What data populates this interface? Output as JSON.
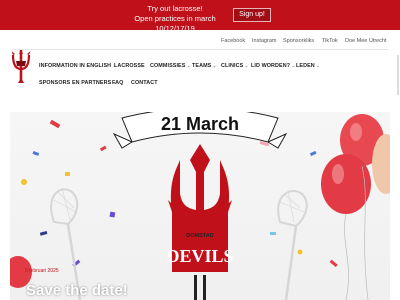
{
  "announcement": {
    "line1": "Try out lacrosse!",
    "line2": "Open practices in march 10/12/17/19",
    "signup_label": "Sign up!"
  },
  "toplinks": [
    "Facebook",
    "Instagram",
    "Sponsorkliks",
    "TikTok",
    "Doe Mee Utrecht"
  ],
  "nav": {
    "row1": [
      {
        "label": "INFORMATION IN ENGLISH",
        "chevron": true
      },
      {
        "label": "LACROSSE",
        "chevron": false
      },
      {
        "label": "COMMISSIES",
        "chevron": true
      },
      {
        "label": "TEAMS",
        "chevron": true
      },
      {
        "label": "CLINICS",
        "chevron": true
      },
      {
        "label": "LID WORDEN?",
        "chevron": true
      },
      {
        "label": "LEDEN",
        "chevron": true
      }
    ],
    "row2": [
      {
        "label": "SPONSORS EN PARTNERS",
        "chevron": true
      },
      {
        "label": "FAQ",
        "chevron": false
      },
      {
        "label": "CONTACT",
        "chevron": false
      }
    ]
  },
  "hero": {
    "banner_text": "21 March",
    "logo_text_top": "DOMSTAD",
    "logo_text_bottom": "DEVILS",
    "date_badge": "5 februari 2025",
    "headline": "Save the date!"
  },
  "colors": {
    "brand_red": "#c0111b",
    "balloon_red": "#e23b45",
    "dark_text": "#222222"
  }
}
